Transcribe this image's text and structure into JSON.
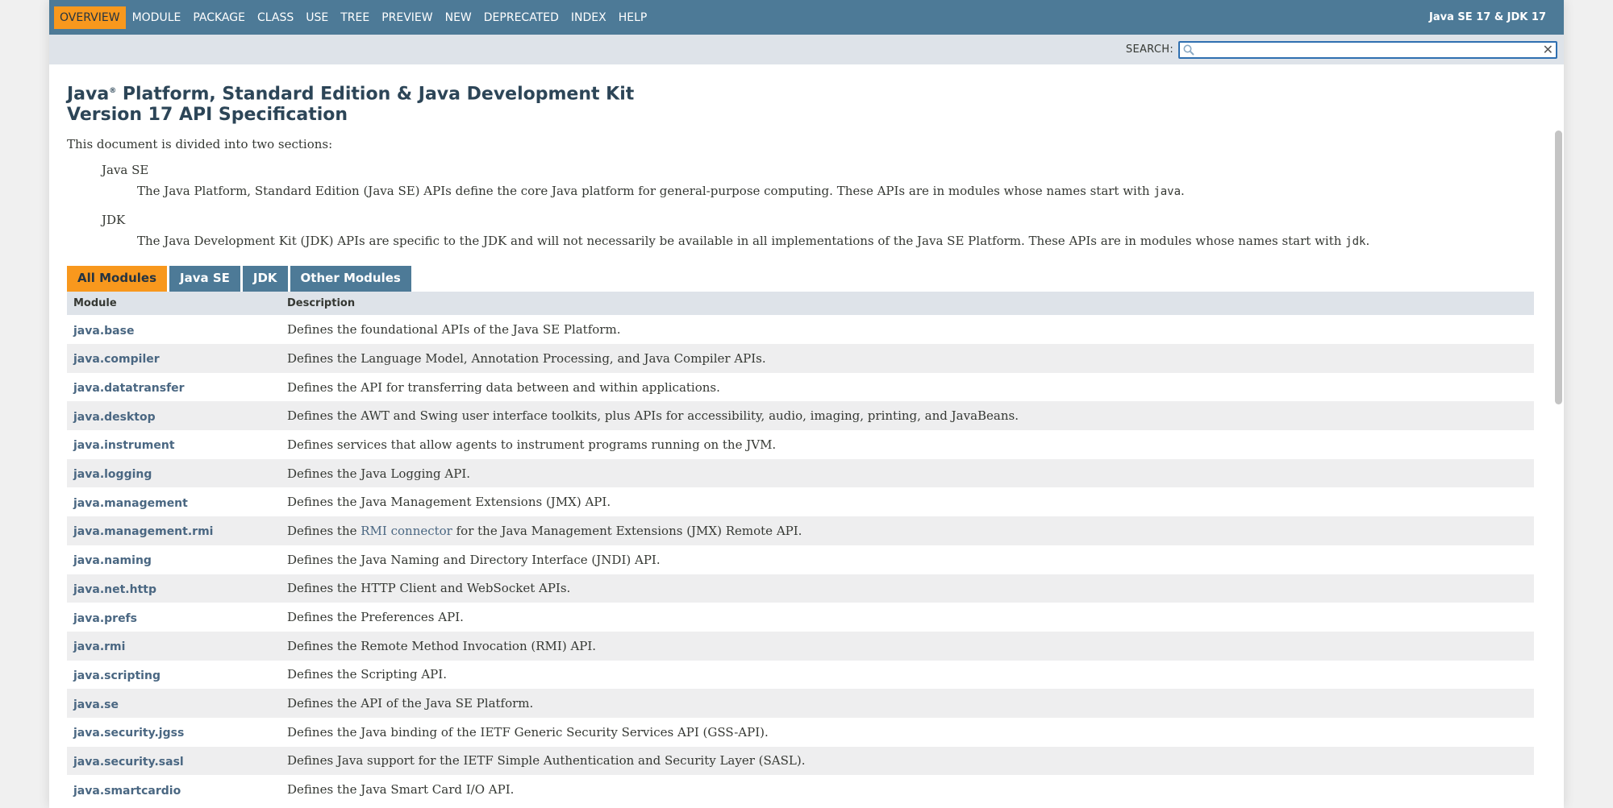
{
  "nav": {
    "items": [
      {
        "label": "Overview",
        "active": true
      },
      {
        "label": "Module",
        "active": false
      },
      {
        "label": "Package",
        "active": false
      },
      {
        "label": "Class",
        "active": false
      },
      {
        "label": "Use",
        "active": false
      },
      {
        "label": "Tree",
        "active": false
      },
      {
        "label": "Preview",
        "active": false
      },
      {
        "label": "New",
        "active": false
      },
      {
        "label": "Deprecated",
        "active": false
      },
      {
        "label": "Index",
        "active": false
      },
      {
        "label": "Help",
        "active": false
      }
    ],
    "about": "Java SE 17 & JDK 17"
  },
  "search": {
    "label": "SEARCH:",
    "value": "",
    "clear": "✕"
  },
  "header": {
    "title_line1_a": "Java",
    "title_reg": "®",
    "title_line1_b": " Platform, Standard Edition & Java Development Kit",
    "title_line2": "Version 17 API Specification"
  },
  "intro": "This document is divided into two sections:",
  "sections": [
    {
      "term": "Java SE",
      "desc": "The Java Platform, Standard Edition (Java SE) APIs define the core Java platform for general-purpose computing. These APIs are in modules whose names start with ",
      "code": "java",
      "tail": "."
    },
    {
      "term": "JDK",
      "desc": "The Java Development Kit (JDK) APIs are specific to the JDK and will not necessarily be available in all implementations of the Java SE Platform. These APIs are in modules whose names start with ",
      "code": "jdk",
      "tail": "."
    }
  ],
  "tabs": [
    {
      "label": "All Modules",
      "active": true
    },
    {
      "label": "Java SE",
      "active": false
    },
    {
      "label": "JDK",
      "active": false
    },
    {
      "label": "Other Modules",
      "active": false
    }
  ],
  "table": {
    "headers": {
      "module": "Module",
      "description": "Description"
    },
    "rows": [
      {
        "module": "java.base",
        "pre": "Defines the foundational APIs of the Java SE Platform.",
        "link": "",
        "post": ""
      },
      {
        "module": "java.compiler",
        "pre": "Defines the Language Model, Annotation Processing, and Java Compiler APIs.",
        "link": "",
        "post": ""
      },
      {
        "module": "java.datatransfer",
        "pre": "Defines the API for transferring data between and within applications.",
        "link": "",
        "post": ""
      },
      {
        "module": "java.desktop",
        "pre": "Defines the AWT and Swing user interface toolkits, plus APIs for accessibility, audio, imaging, printing, and JavaBeans.",
        "link": "",
        "post": ""
      },
      {
        "module": "java.instrument",
        "pre": "Defines services that allow agents to instrument programs running on the JVM.",
        "link": "",
        "post": ""
      },
      {
        "module": "java.logging",
        "pre": "Defines the Java Logging API.",
        "link": "",
        "post": ""
      },
      {
        "module": "java.management",
        "pre": "Defines the Java Management Extensions (JMX) API.",
        "link": "",
        "post": ""
      },
      {
        "module": "java.management.rmi",
        "pre": "Defines the ",
        "link": "RMI connector",
        "post": " for the Java Management Extensions (JMX) Remote API."
      },
      {
        "module": "java.naming",
        "pre": "Defines the Java Naming and Directory Interface (JNDI) API.",
        "link": "",
        "post": ""
      },
      {
        "module": "java.net.http",
        "pre": "Defines the HTTP Client and WebSocket APIs.",
        "link": "",
        "post": ""
      },
      {
        "module": "java.prefs",
        "pre": "Defines the Preferences API.",
        "link": "",
        "post": ""
      },
      {
        "module": "java.rmi",
        "pre": "Defines the Remote Method Invocation (RMI) API.",
        "link": "",
        "post": ""
      },
      {
        "module": "java.scripting",
        "pre": "Defines the Scripting API.",
        "link": "",
        "post": ""
      },
      {
        "module": "java.se",
        "pre": "Defines the API of the Java SE Platform.",
        "link": "",
        "post": ""
      },
      {
        "module": "java.security.jgss",
        "pre": "Defines the Java binding of the IETF Generic Security Services API (GSS-API).",
        "link": "",
        "post": ""
      },
      {
        "module": "java.security.sasl",
        "pre": "Defines Java support for the IETF Simple Authentication and Security Layer (SASL).",
        "link": "",
        "post": ""
      },
      {
        "module": "java.smartcardio",
        "pre": "Defines the Java Smart Card I/O API.",
        "link": "",
        "post": ""
      }
    ]
  },
  "colors": {
    "nav_bg": "#4d7a97",
    "accent": "#f8981d",
    "subnav_bg": "#dee3e9",
    "link": "#4a6782",
    "title": "#2c4557"
  }
}
